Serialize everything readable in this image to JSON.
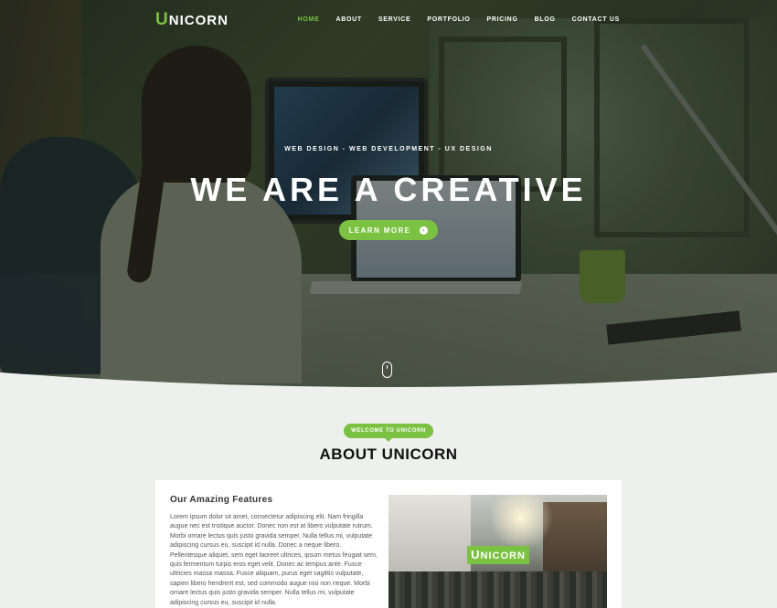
{
  "nav": {
    "logo_initial": "U",
    "logo_rest": "NICORN",
    "items": [
      {
        "label": "HOME",
        "active": true
      },
      {
        "label": "ABOUT",
        "active": false
      },
      {
        "label": "SERVICE",
        "active": false
      },
      {
        "label": "PORTFOLIO",
        "active": false
      },
      {
        "label": "PRICING",
        "active": false
      },
      {
        "label": "BLOG",
        "active": false
      },
      {
        "label": "CONTACT US",
        "active": false
      }
    ]
  },
  "hero": {
    "subtitle": "WEB DESIGN - WEB DEVELOPMENT - UX DESIGN",
    "title": "WE ARE A CREATIVE",
    "button_label": "LEARN MORE",
    "button_icon": "chevron-right-circle-icon",
    "scroll_icon": "mouse-scroll-icon"
  },
  "about": {
    "badge": "WELCOME TO UNICORN",
    "title": "ABOUT UNICORN",
    "card": {
      "heading": "Our Amazing Features",
      "text": "Lorem ipsum dolor sit amet, consectetur adipiscing elit. Nam fringilla augue nec est tristique auctor. Donec non est at libero vulputate rutrum. Morbi ornare lectus quis justo gravida semper. Nulla tellus mi, vulputate adipiscing cursus eu, suscipit id nulla. Donec a neque libero. Pellentesque aliquet, sem eget laoreet ultrices, ipsum metus feugiat sem, quis fermentum turpis eros eget velit. Donec ac tempus ante. Fusce ultricies massa massa. Fusce aliquam, purus eget sagittis vulputate, sapien libero hendrerit est, sed commodo augue nisi non neque. Morbi ornare lectus quis justo gravida semper. Nulla tellus mi, vulputate adipiscing cursus eu, suscipit id nulla.",
      "photo_logo_initial": "U",
      "photo_logo_rest": "NICORN"
    }
  },
  "colors": {
    "accent": "#7cc242",
    "background": "#eef0ee",
    "card": "#ffffff"
  }
}
